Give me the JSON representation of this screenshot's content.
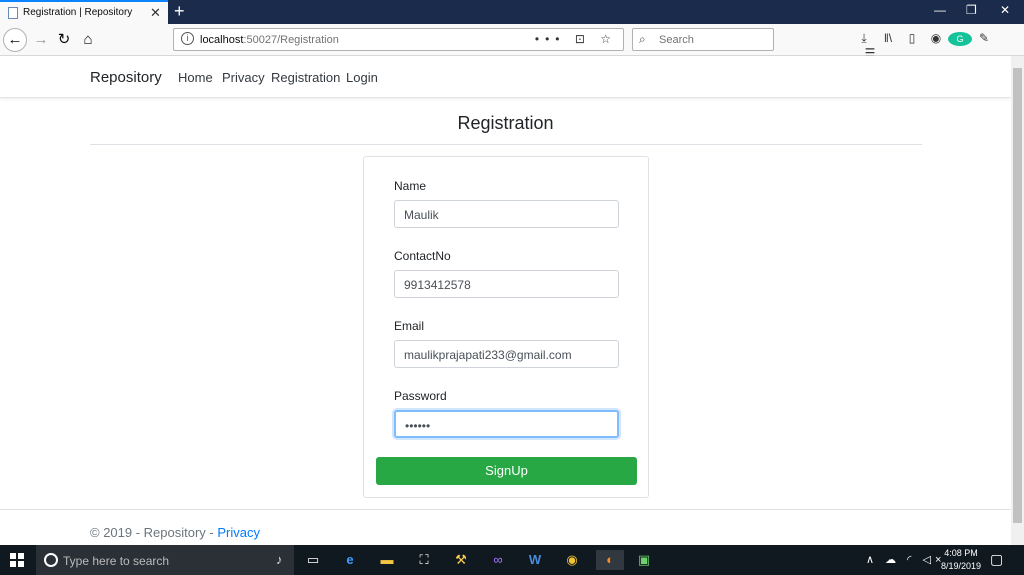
{
  "browser": {
    "tab_title": "Registration | Repository",
    "tab_close": "✕",
    "new_tab": "+",
    "url_host": "localhost",
    "url_rest": ":50027/Registration",
    "url_actions": "••• ⊡ ☆",
    "search_placeholder": "Search",
    "window": {
      "minimize": "—",
      "restore": "❐",
      "close": "✕"
    }
  },
  "site": {
    "brand": "Repository",
    "nav": [
      "Home",
      "Privacy",
      "Registration",
      "Login"
    ],
    "page_title": "Registration"
  },
  "form": {
    "name_label": "Name",
    "name_value": "Maulik",
    "contact_label": "ContactNo",
    "contact_value": "9913412578",
    "email_label": "Email",
    "email_value": "maulikprajapati233@gmail.com",
    "password_label": "Password",
    "password_value": "••••••",
    "submit_label": "SignUp"
  },
  "footer": {
    "text": "© 2019 - Repository - ",
    "link": "Privacy"
  },
  "taskbar": {
    "search_placeholder": "Type here to search",
    "time": "4:08 PM",
    "date": "8/19/2019"
  },
  "colors": {
    "submit_button": "#28a745",
    "link": "#007bff",
    "focus_border": "#80bdff",
    "titlebar": "#1b2b4b"
  }
}
